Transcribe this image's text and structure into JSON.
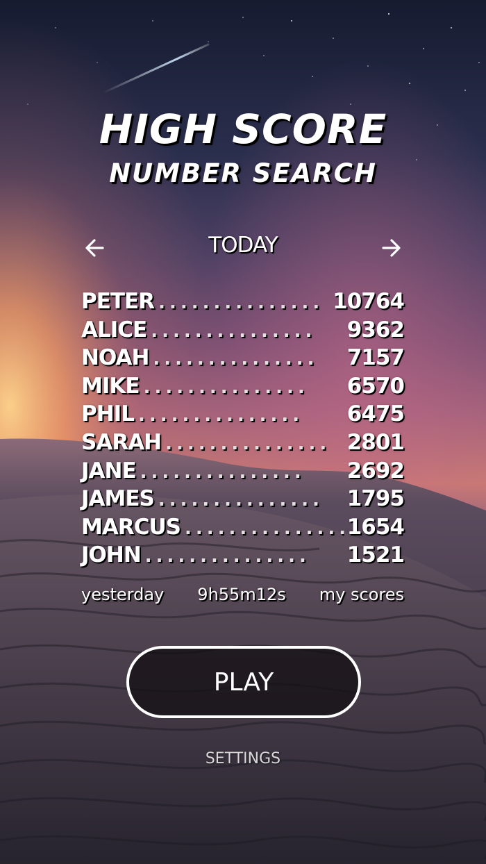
{
  "header": {
    "title": "HIGH SCORE",
    "subtitle": "NUMBER SEARCH"
  },
  "period": {
    "label": "TODAY",
    "prev_icon": "arrow-left-icon",
    "next_icon": "arrow-right-icon"
  },
  "leaderboard": {
    "dots": "...............",
    "entries": [
      {
        "name": "PETER",
        "score": "10764"
      },
      {
        "name": "ALICE",
        "score": "9362"
      },
      {
        "name": "NOAH",
        "score": "7157"
      },
      {
        "name": "MIKE",
        "score": "6570"
      },
      {
        "name": "PHIL",
        "score": "6475"
      },
      {
        "name": "SARAH",
        "score": "2801"
      },
      {
        "name": "JANE",
        "score": "2692"
      },
      {
        "name": "JAMES",
        "score": "1795"
      },
      {
        "name": "MARCUS",
        "score": "1654"
      },
      {
        "name": "JOHN",
        "score": "1521"
      }
    ]
  },
  "footer": {
    "yesterday": "yesterday",
    "countdown": "9h55m12s",
    "my_scores": "my scores"
  },
  "play_label": "PLAY",
  "settings_label": "SETTINGS",
  "colors": {
    "sky_top": "#1b2036",
    "sky_mid": "#6f4a6c",
    "horizon_glow": "#f3a86a",
    "dune_dark": "#2f2c38"
  }
}
